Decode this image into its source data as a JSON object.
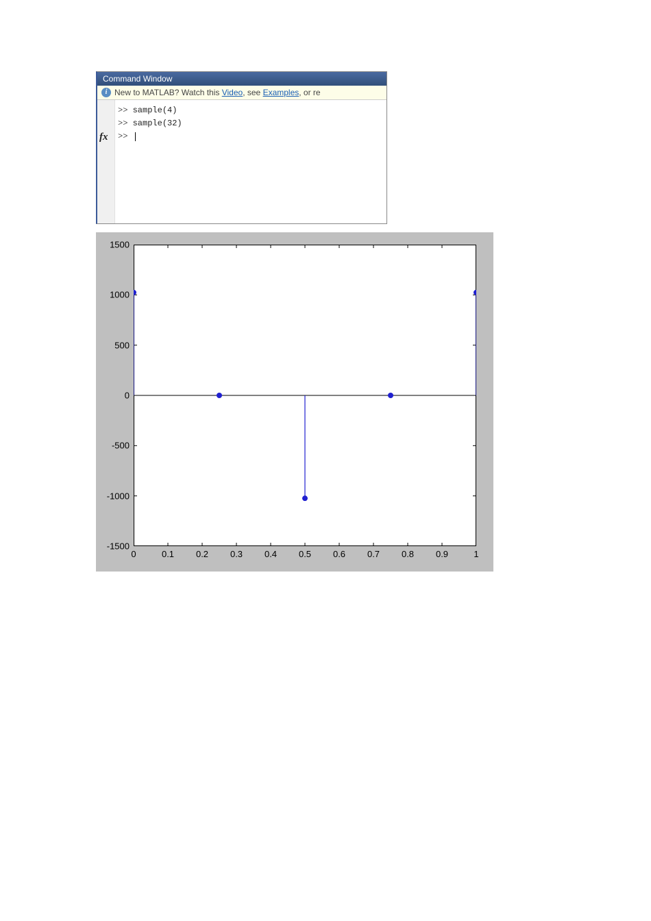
{
  "command_window": {
    "title": "Command Window",
    "banner": {
      "prefix": "New to MATLAB? Watch this ",
      "link1": "Video",
      "mid": ", see ",
      "link2": "Examples",
      "suffix": ", or re"
    },
    "lines": [
      "sample(4)",
      "sample(32)"
    ],
    "prompt": ">>"
  },
  "chart_data": {
    "type": "stem",
    "x": [
      0,
      0.25,
      0.5,
      0.75,
      1
    ],
    "y": [
      1024,
      0,
      -1024,
      0,
      1024
    ],
    "xlim": [
      0,
      1
    ],
    "ylim": [
      -1500,
      1500
    ],
    "xticks": [
      0,
      0.1,
      0.2,
      0.3,
      0.4,
      0.5,
      0.6,
      0.7,
      0.8,
      0.9,
      1
    ],
    "yticks": [
      -1500,
      -1000,
      -500,
      0,
      500,
      1000,
      1500
    ],
    "xtick_labels": [
      "0",
      "0.1",
      "0.2",
      "0.3",
      "0.4",
      "0.5",
      "0.6",
      "0.7",
      "0.8",
      "0.9",
      "1"
    ],
    "ytick_labels": [
      "-1500",
      "-1000",
      "-500",
      "0",
      "500",
      "1000",
      "1500"
    ]
  }
}
